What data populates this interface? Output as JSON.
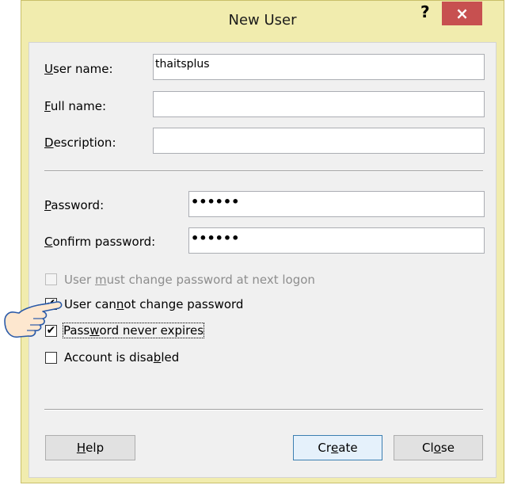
{
  "window": {
    "title": "New User",
    "help_glyph": "?",
    "close_glyph": "×"
  },
  "form": {
    "username": {
      "label_pre": "",
      "label_key": "U",
      "label_post": "ser name:",
      "value": "thaitsplus"
    },
    "fullname": {
      "label_pre": "",
      "label_key": "F",
      "label_post": "ull name:",
      "value": ""
    },
    "description": {
      "label_pre": "",
      "label_key": "D",
      "label_post": "escription:",
      "value": ""
    },
    "password": {
      "label_pre": "",
      "label_key": "P",
      "label_post": "assword:",
      "value": "••••••"
    },
    "confirm": {
      "label_pre": "",
      "label_key": "C",
      "label_post": "onfirm password:",
      "value": "••••••"
    }
  },
  "options": {
    "must_change": {
      "pre": "User ",
      "key": "m",
      "post": "ust change password at next logon",
      "checked": false,
      "disabled": true
    },
    "cannot_change": {
      "pre": "User can",
      "key": "n",
      "post": "ot change password",
      "checked": true,
      "disabled": false
    },
    "never_expires": {
      "pre": "Pass",
      "key": "w",
      "post": "ord never expires",
      "checked": true,
      "disabled": false
    },
    "disabled": {
      "pre": "Account is disa",
      "key": "b",
      "post": "led",
      "checked": false,
      "disabled": false
    }
  },
  "buttons": {
    "help": {
      "pre": "",
      "key": "H",
      "post": "elp"
    },
    "create": {
      "pre": "Cr",
      "key": "e",
      "post": "ate"
    },
    "close": {
      "pre": "Cl",
      "key": "o",
      "post": "se"
    }
  },
  "colors": {
    "frame": "#f1ecae",
    "close_button": "#c75050",
    "client": "#f0f0f0"
  },
  "icons": {
    "check_glyph": "✔",
    "pointer": "pointing-hand-icon"
  }
}
